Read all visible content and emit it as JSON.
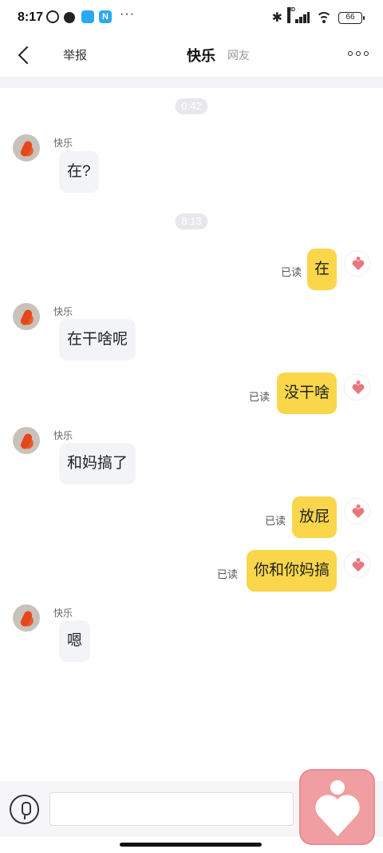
{
  "status_bar": {
    "time": "8:17",
    "more": "···",
    "app_badge": "N",
    "network": "HD",
    "battery": "66"
  },
  "header": {
    "report_label": "举报",
    "title": "快乐",
    "subtitle": "网友"
  },
  "messages": [
    {
      "type": "time",
      "text": "0:42"
    },
    {
      "type": "incoming",
      "sender": "快乐",
      "text": "在?"
    },
    {
      "type": "time",
      "text": "8:13"
    },
    {
      "type": "outgoing",
      "status": "已读",
      "text": "在"
    },
    {
      "type": "incoming",
      "sender": "快乐",
      "text": "在干啥呢"
    },
    {
      "type": "outgoing",
      "status": "已读",
      "text": "没干啥"
    },
    {
      "type": "incoming",
      "sender": "快乐",
      "text": "和妈搞了"
    },
    {
      "type": "outgoing",
      "status": "已读",
      "text": "放屁"
    },
    {
      "type": "outgoing",
      "status": "已读",
      "text": "你和你妈搞"
    },
    {
      "type": "incoming",
      "sender": "快乐",
      "text": "嗯"
    }
  ],
  "input": {
    "value": "",
    "placeholder": ""
  },
  "colors": {
    "outgoing_bubble": "#f9d64a",
    "incoming_bubble": "#f3f4f7",
    "heart_button": "#f09ea2",
    "heart_icon": "#e8767d"
  },
  "icons": {
    "back": "chevron-left-icon",
    "more": "more-horizontal-icon",
    "mic": "microphone-icon",
    "heart": "heart-icon"
  }
}
